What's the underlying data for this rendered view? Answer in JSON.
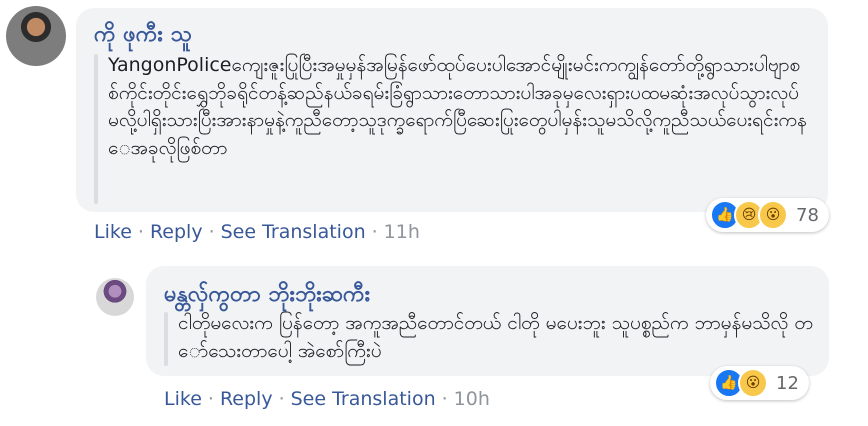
{
  "comments": [
    {
      "author": "ကို ဖုကီး သူ",
      "text": "YangonPoliceကျေးဇူးပြုပြီးအမှုမှန်အမြန်ဖော်ထုပ်ပေးပါအောင်မျိုးမင်းကကျွန်တော်တို့ရွာသားပါဗျာစစ်ကိုင်းတိုင်းရွှေဘိုခရိုင်တန့်ဆည်နယ်ခရမ်းခြံရွာသားတောသားပါအခုမှလေးရှားပထမဆုံးအလုပ်သွားလုပ်မလို့ပါရှိးသားပြီးအားနာမှုနဲ့ကူညီတော့သူဒုက္ခရောက်ပြီဆေးပြုးတွေပါမှန်းသူမသိလို့ကူညီသယ်ပေးရင်းကနေအခုလိုဖြစ်တာ",
      "reactions": {
        "icons": [
          "like-icon",
          "sad-icon",
          "wow-icon"
        ],
        "count": "78"
      },
      "actions": {
        "like": "Like",
        "reply": "Reply",
        "translate": "See Translation",
        "time": "11h"
      }
    },
    {
      "author": "မန္တလှ်ကွတာ ဘိုးဘိုးဆကီး",
      "text": "ငါတိုမလေးက ပြန်တော့ အကူအညီတောင်တယ် ငါတို မပေးဘူး သူပစ္စည်က ဘာမှန်မသိလို တော်သေးတာပေါ့ အဲစော်ကြီးပဲ",
      "reactions": {
        "icons": [
          "like-icon",
          "wow-icon"
        ],
        "count": "12"
      },
      "actions": {
        "like": "Like",
        "reply": "Reply",
        "translate": "See Translation",
        "time": "10h"
      }
    }
  ],
  "separator": "·",
  "colors": {
    "link": "#385898",
    "bubble": "#f2f3f5",
    "like": "#1877f2",
    "meta": "#90949c"
  }
}
